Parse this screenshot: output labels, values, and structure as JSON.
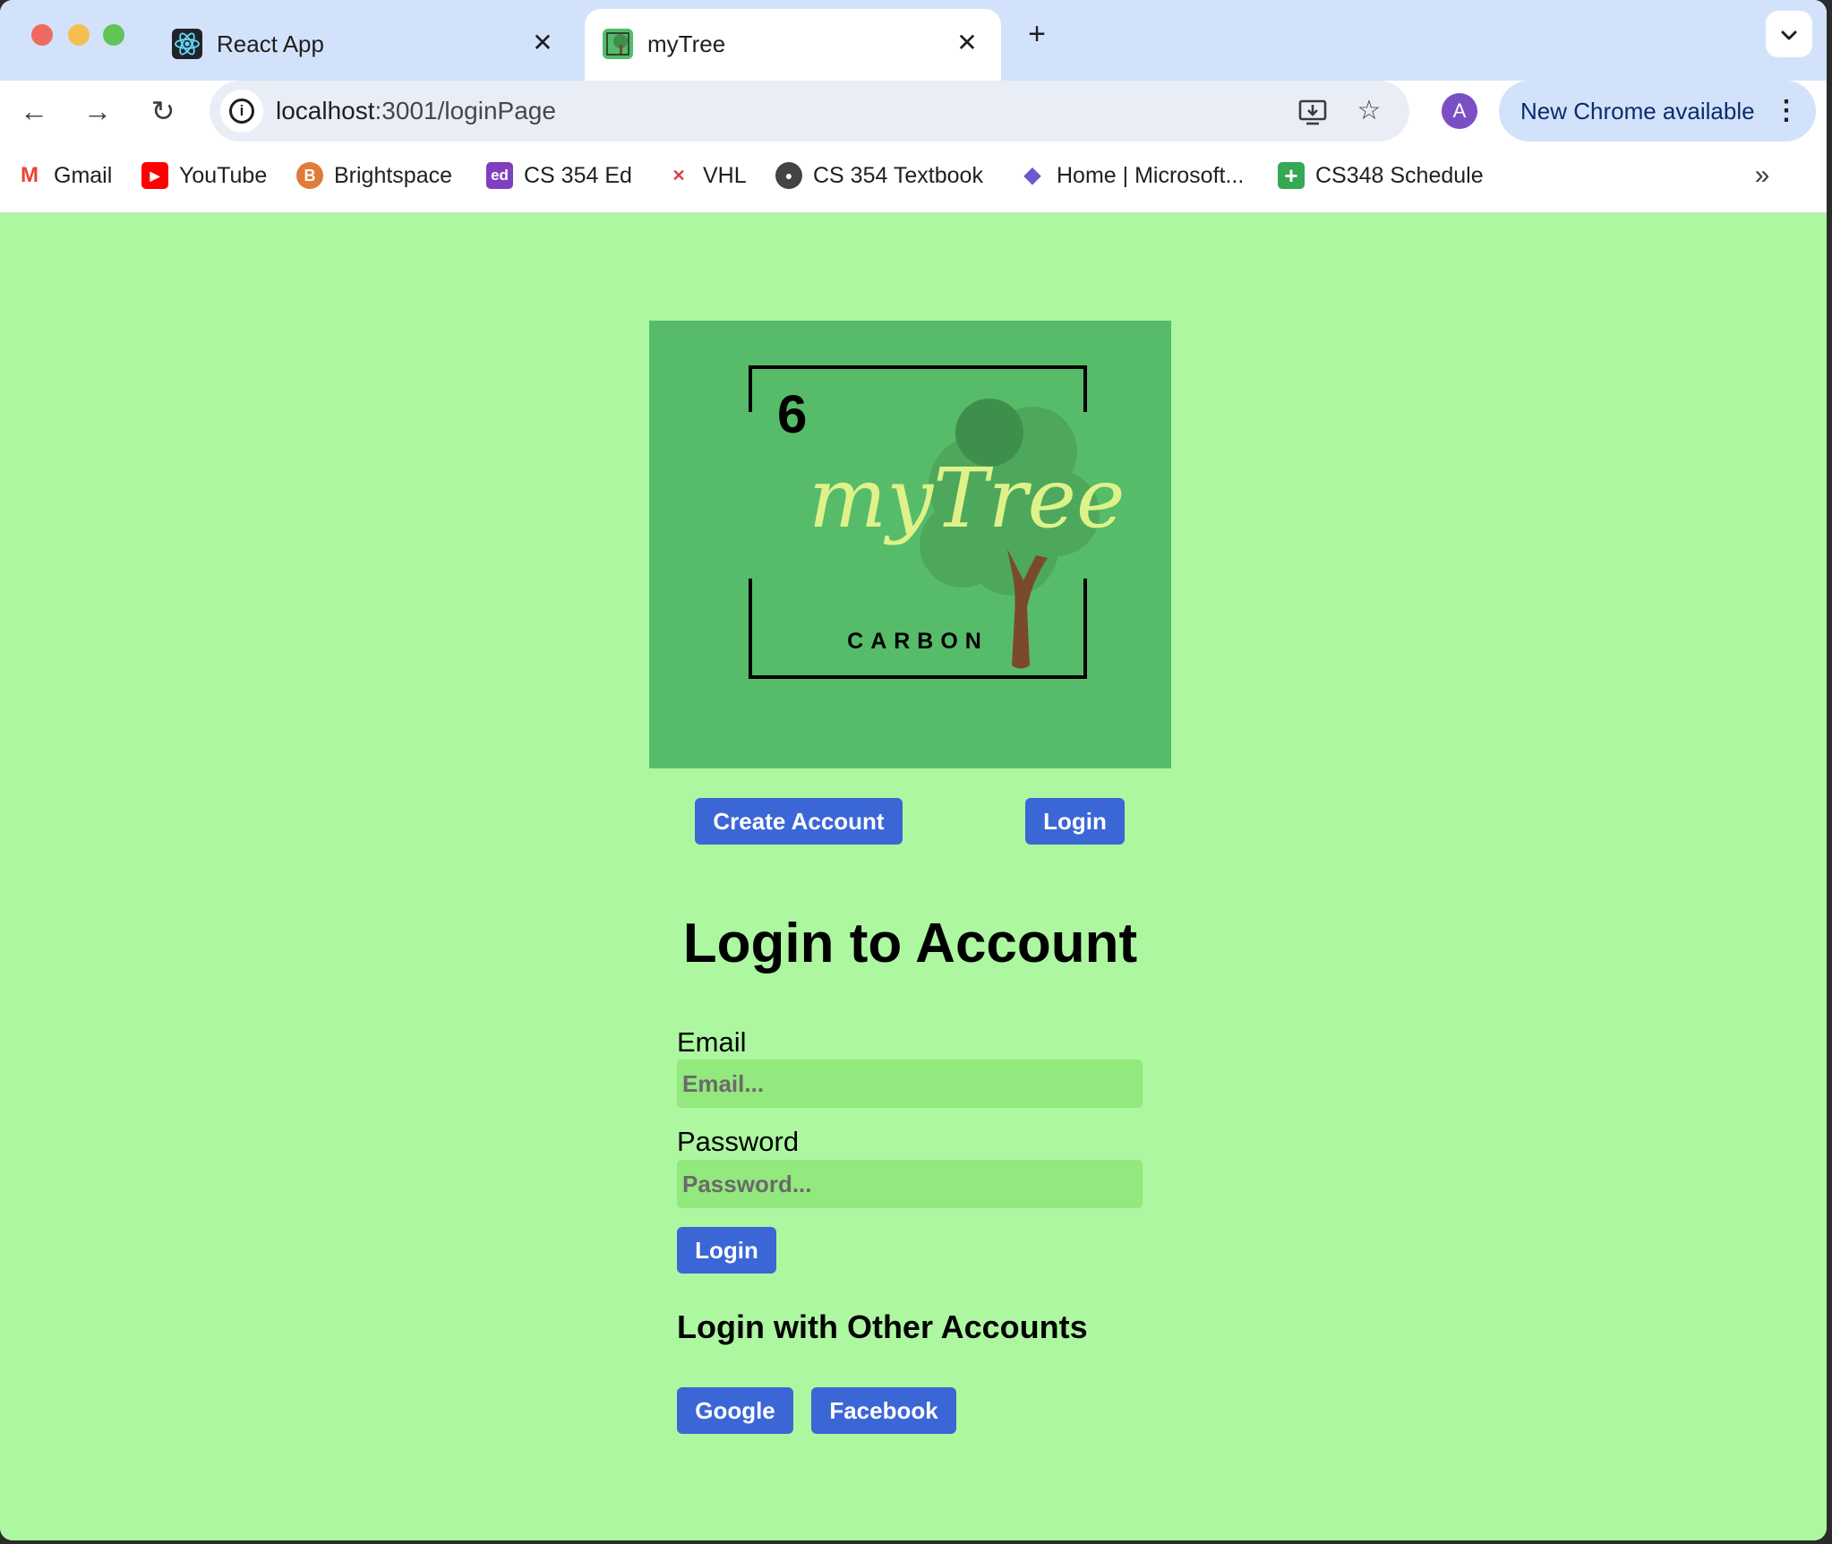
{
  "browser": {
    "tabs": [
      {
        "title": "React App",
        "favicon": "react-logo-icon",
        "active": false
      },
      {
        "title": "myTree",
        "favicon": "mytree-logo-icon",
        "active": true
      }
    ],
    "new_tab_symbol": "+",
    "tab_close_symbol": "✕",
    "tab_search_symbol": "⌄",
    "address": {
      "host": "localhost",
      "path": ":3001/loginPage"
    },
    "profile_initial": "A",
    "update_chip": "New Chrome available",
    "update_chip_menu": "⋮",
    "nav_symbols": {
      "back": "←",
      "forward": "→",
      "reload": "↻",
      "install": "⎙",
      "star": "☆",
      "more_bookmarks": "»"
    },
    "bookmarks": [
      {
        "label": "Gmail",
        "icon": "gmail-icon",
        "color": "#ea4335",
        "glyph": "M"
      },
      {
        "label": "YouTube",
        "icon": "youtube-icon",
        "color": "#ff0000",
        "glyph": "▶"
      },
      {
        "label": "Brightspace",
        "icon": "brightspace-icon",
        "color": "#e07b39",
        "glyph": "B"
      },
      {
        "label": "CS 354 Ed",
        "icon": "ed-icon",
        "color": "#7f3fbf",
        "glyph": "ed"
      },
      {
        "label": "VHL",
        "icon": "vhl-icon",
        "color": "#ffffff",
        "glyph": "✕"
      },
      {
        "label": "CS 354 Textbook",
        "icon": "globe-icon",
        "color": "#444444",
        "glyph": "●"
      },
      {
        "label": "Home | Microsoft...",
        "icon": "microsoft-icon",
        "color": "#6a5acd",
        "glyph": "◆"
      },
      {
        "label": "CS348 Schedule",
        "icon": "sheets-icon",
        "color": "#34a853",
        "glyph": "+"
      }
    ]
  },
  "logo": {
    "number": "6",
    "script_text": "myTree",
    "caption": "CARBON",
    "colors": {
      "background": "#56bc6a",
      "script": "#dff28a",
      "trunk": "#7a4a2a",
      "foliage_dark": "#3f8f4c",
      "foliage_light": "#4ea85c"
    }
  },
  "nav": {
    "create_account": "Create Account",
    "login": "Login"
  },
  "form": {
    "heading": "Login to Account",
    "email_label": "Email",
    "email_placeholder": "Email...",
    "password_label": "Password",
    "password_placeholder": "Password...",
    "submit": "Login"
  },
  "social": {
    "heading": "Login with Other Accounts",
    "google": "Google",
    "facebook": "Facebook"
  },
  "colors": {
    "page_bg": "#adf7a1",
    "button": "#3b66d6",
    "input_bg": "#93e87e"
  }
}
